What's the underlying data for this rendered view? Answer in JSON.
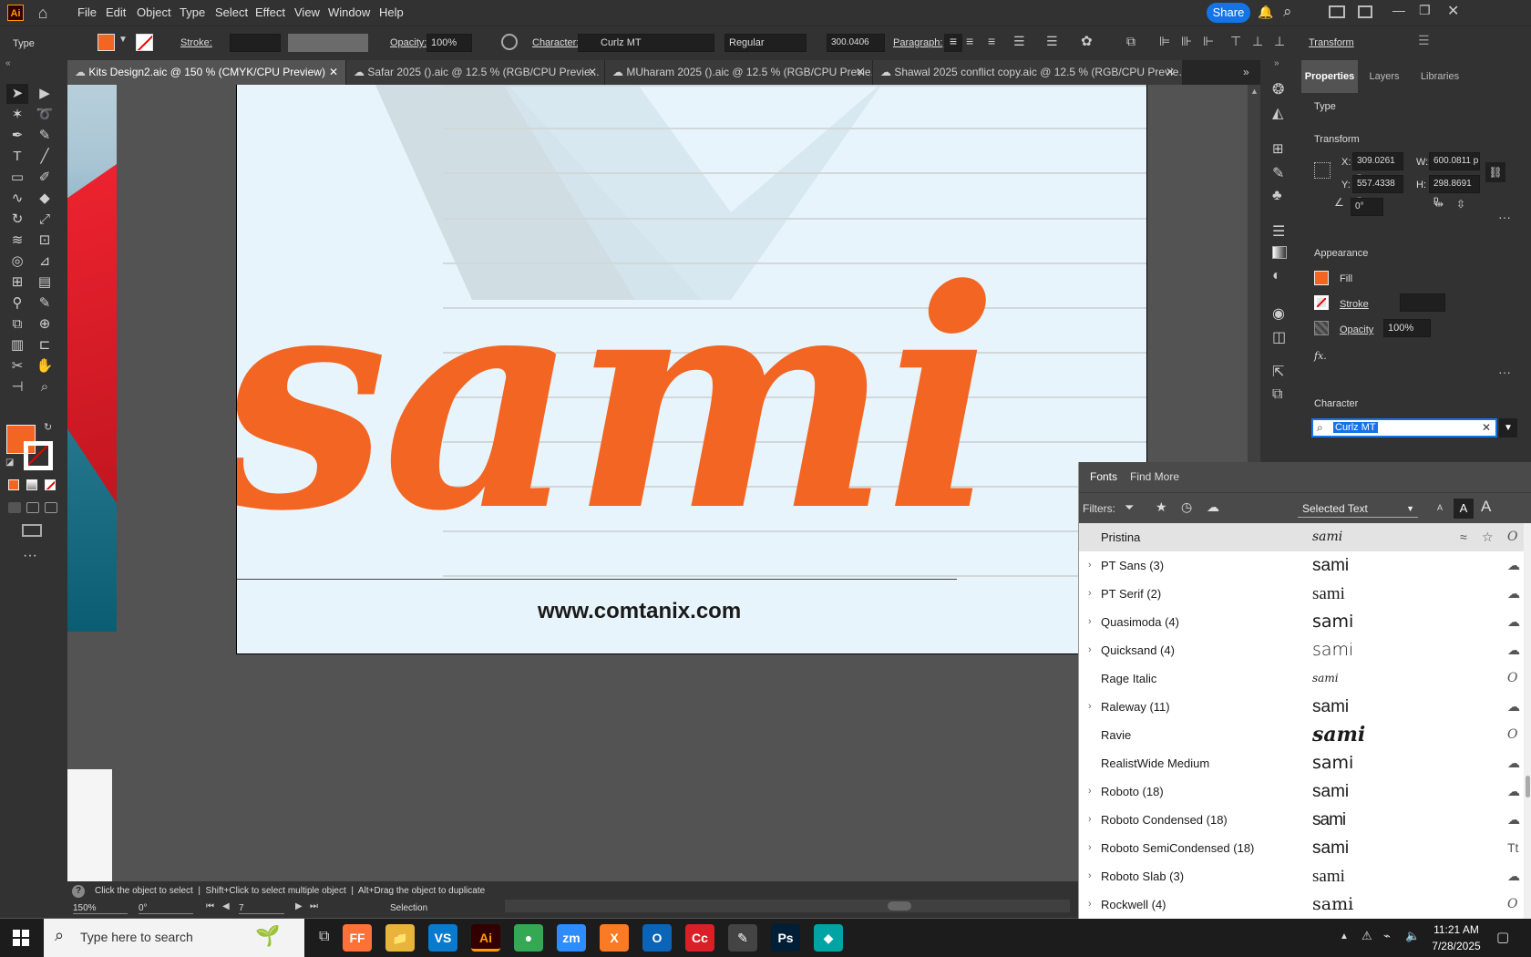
{
  "app": {
    "logo": "Ai"
  },
  "menu": [
    "File",
    "Edit",
    "Object",
    "Type",
    "Select",
    "Effect",
    "View",
    "Window",
    "Help"
  ],
  "share_label": "Share",
  "control": {
    "type_label": "Type",
    "stroke_label": "Stroke:",
    "opacity_label": "Opacity:",
    "opacity_value": "100%",
    "character_label": "Character:",
    "font_value": "Curlz MT",
    "style_value": "Regular",
    "size_value": "300.0406",
    "paragraph_label": "Paragraph:",
    "transform_label": "Transform"
  },
  "tabs": [
    "Kits Design2.aic @ 150 % (CMYK/CPU Preview)",
    "Safar 2025 ().aic @ 12.5 % (RGB/CPU Previe...",
    "MUharam 2025 ().aic @ 12.5 % (RGB/CPU Previe...",
    "Shawal 2025 conflict copy.aic @ 12.5 % (RGB/CPU Previe..."
  ],
  "artboard": {
    "headline": "sami",
    "website": "www.comtanix.com",
    "accent": "#f26522"
  },
  "properties": {
    "tabs": [
      "Properties",
      "Layers",
      "Libraries"
    ],
    "section_type": "Type",
    "section_transform": "Transform",
    "x_label": "X:",
    "x_value": "309.0261 p",
    "y_label": "Y:",
    "y_value": "557.4338 p",
    "w_label": "W:",
    "w_value": "600.0811 p",
    "h_label": "H:",
    "h_value": "298.8691 p",
    "angle_value": "0°",
    "section_appearance": "Appearance",
    "fill_label": "Fill",
    "stroke_label": "Stroke",
    "opacity_label": "Opacity",
    "opacity_value": "100%",
    "fx_label": "fx.",
    "section_character": "Character",
    "font_search_value": "Curlz MT"
  },
  "fonts_panel": {
    "tab_fonts": "Fonts",
    "tab_find_more": "Find More",
    "filters_label": "Filters:",
    "selected_text_label": "Selected Text",
    "sample_size_labels": [
      "A",
      "A",
      "A"
    ],
    "rows": [
      {
        "name": "Pristina",
        "sample": "sami",
        "expandable": false,
        "icon": "O",
        "highlight": true
      },
      {
        "name": "PT Sans (3)",
        "sample": "sami",
        "expandable": true,
        "icon": "☁"
      },
      {
        "name": "PT Serif (2)",
        "sample": "sami",
        "expandable": true,
        "icon": "☁"
      },
      {
        "name": "Quasimoda (4)",
        "sample": "sami",
        "expandable": true,
        "icon": "☁"
      },
      {
        "name": "Quicksand (4)",
        "sample": "sami",
        "expandable": true,
        "icon": "☁"
      },
      {
        "name": "Rage Italic",
        "sample": "sami",
        "expandable": false,
        "icon": "O"
      },
      {
        "name": "Raleway (11)",
        "sample": "sami",
        "expandable": true,
        "icon": "☁"
      },
      {
        "name": "Ravie",
        "sample": "sami",
        "expandable": false,
        "icon": "O"
      },
      {
        "name": "RealistWide Medium",
        "sample": "sami",
        "expandable": false,
        "icon": "☁"
      },
      {
        "name": "Roboto (18)",
        "sample": "sami",
        "expandable": true,
        "icon": "☁"
      },
      {
        "name": "Roboto Condensed (18)",
        "sample": "sami",
        "expandable": true,
        "icon": "☁"
      },
      {
        "name": "Roboto SemiCondensed (18)",
        "sample": "sami",
        "expandable": true,
        "icon": "Tt"
      },
      {
        "name": "Roboto Slab (3)",
        "sample": "sami",
        "expandable": true,
        "icon": "☁"
      },
      {
        "name": "Rockwell (4)",
        "sample": "sami",
        "expandable": true,
        "icon": "O"
      }
    ]
  },
  "status": {
    "hint": "Click the object to select  |  Shift+Click to select multiple object  |  Alt+Drag the object to duplicate",
    "zoom": "150%",
    "rotation": "0°",
    "artboard_num": "7",
    "tool": "Selection"
  },
  "taskbar": {
    "search_placeholder": "Type here to search",
    "time": "11:21 AM",
    "date": "7/28/2025",
    "apps": [
      {
        "label": "FF",
        "color": "#ff7139"
      },
      {
        "label": "📁",
        "color": "#e8b53a"
      },
      {
        "label": "VS",
        "color": "#0a7acc"
      },
      {
        "label": "Ai",
        "color": "#330000"
      },
      {
        "label": "●",
        "color": "#34a853"
      },
      {
        "label": "zm",
        "color": "#2d8cff"
      },
      {
        "label": "X",
        "color": "#fb7a24"
      },
      {
        "label": "O",
        "color": "#0a64b8"
      },
      {
        "label": "Cc",
        "color": "#da1f26"
      },
      {
        "label": "✎",
        "color": "#444444"
      },
      {
        "label": "Ps",
        "color": "#001e36"
      },
      {
        "label": "◆",
        "color": "#00a4a4"
      }
    ]
  }
}
